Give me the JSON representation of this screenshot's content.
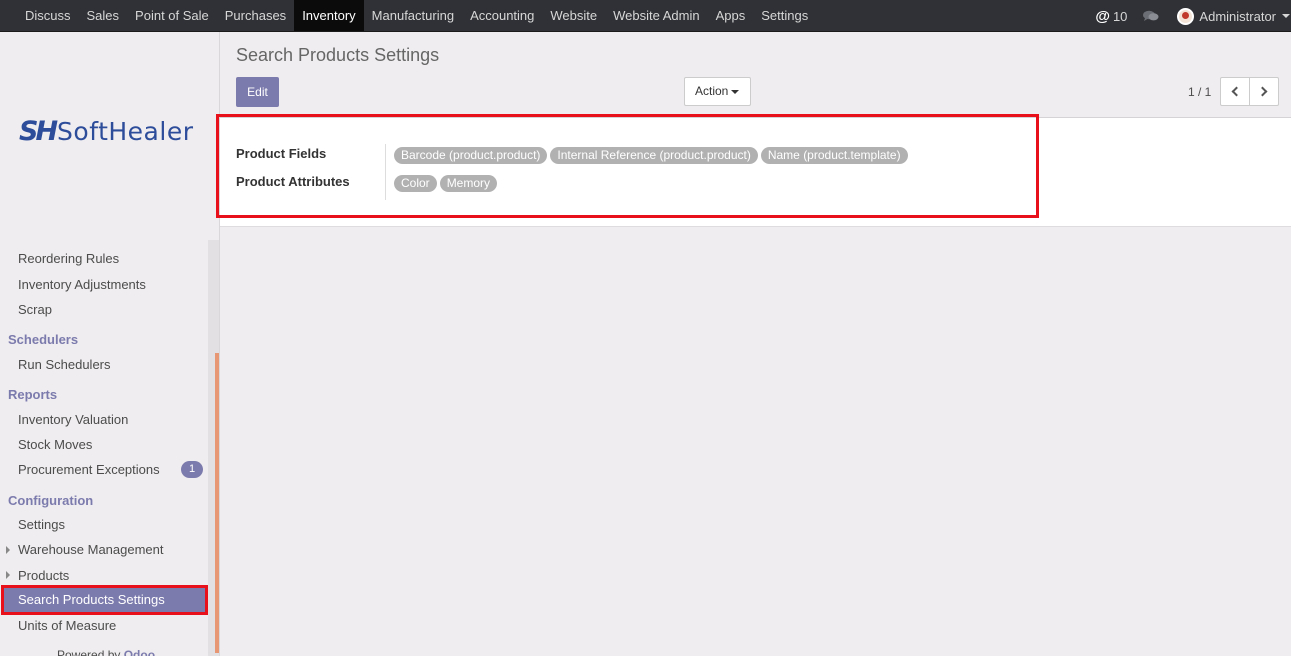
{
  "topbar": {
    "menu": [
      "Discuss",
      "Sales",
      "Point of Sale",
      "Purchases",
      "Inventory",
      "Manufacturing",
      "Accounting",
      "Website",
      "Website Admin",
      "Apps",
      "Settings"
    ],
    "active_menu": "Inventory",
    "mentions_count": "10",
    "user_name": "Administrator"
  },
  "logo": {
    "mark": "SH",
    "word": "SoftHealer"
  },
  "sidebar": {
    "items_top": [
      "Reordering Rules",
      "Inventory Adjustments",
      "Scrap"
    ],
    "schedulers_header": "Schedulers",
    "schedulers_items": [
      "Run Schedulers"
    ],
    "reports_header": "Reports",
    "reports_items": [
      "Inventory Valuation",
      "Stock Moves",
      "Procurement Exceptions"
    ],
    "procurement_badge": "1",
    "configuration_header": "Configuration",
    "configuration_items": [
      "Settings",
      "Warehouse Management",
      "Products",
      "Search Products Settings",
      "Units of Measure"
    ],
    "active_item": "Search Products Settings",
    "powered_by_prefix": "Powered by",
    "powered_by_brand": "Odoo"
  },
  "control_panel": {
    "title": "Search Products Settings",
    "edit_label": "Edit",
    "action_label": "Action",
    "pager": "1 / 1"
  },
  "form": {
    "product_fields_label": "Product Fields",
    "product_fields_tags": [
      "Barcode (product.product)",
      "Internal Reference (product.product)",
      "Name (product.template)"
    ],
    "product_attributes_label": "Product Attributes",
    "product_attributes_tags": [
      "Color",
      "Memory"
    ]
  },
  "colors": {
    "navbar_bg": "#2f3136",
    "accent": "#7c7bad",
    "highlight_border": "#e8101a",
    "tag_bg": "#b2b1b2"
  }
}
